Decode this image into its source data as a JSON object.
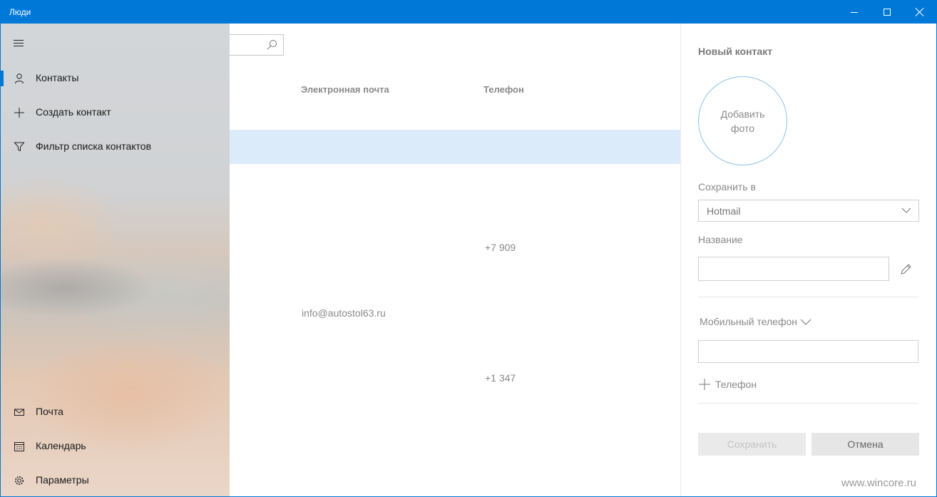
{
  "window": {
    "title": "Люди"
  },
  "nav": {
    "items_top": [
      {
        "label": "Контакты",
        "icon": "person-icon"
      },
      {
        "label": "Создать контакт",
        "icon": "plus-icon"
      },
      {
        "label": "Фильтр списка контактов",
        "icon": "filter-icon"
      }
    ],
    "items_bottom": [
      {
        "label": "Почта",
        "icon": "mail-icon"
      },
      {
        "label": "Календарь",
        "icon": "calendar-icon"
      },
      {
        "label": "Параметры",
        "icon": "gear-icon"
      }
    ]
  },
  "list": {
    "columns": {
      "email": "Электронная почта",
      "phone": "Телефон"
    },
    "cells": {
      "phone_1": "+7 909",
      "email_1": "info@autostol63.ru",
      "phone_2": "+1 347"
    }
  },
  "panel": {
    "title": "Новый контакт",
    "add_photo": "Добавить фото",
    "save_in_label": "Сохранить в",
    "save_in_value": "Hotmail",
    "name_label": "Название",
    "mobile_label": "Мобильный телефон",
    "add_phone": "Телефон",
    "save_button": "Сохранить",
    "cancel_button": "Отмена"
  },
  "watermark": "www.wincore.ru",
  "colors": {
    "accent": "#0078d7",
    "selection": "#dcebfa"
  }
}
